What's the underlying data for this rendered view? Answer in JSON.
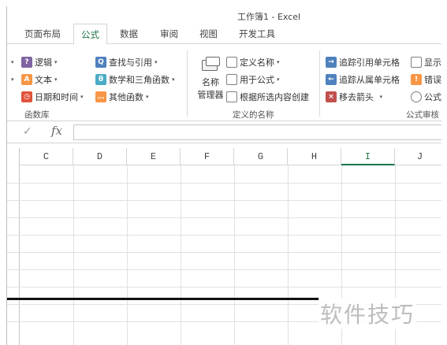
{
  "window": {
    "title": "工作簿1 - Excel"
  },
  "tabs": [
    {
      "label": "页面布局"
    },
    {
      "label": "公式",
      "active": true
    },
    {
      "label": "数据"
    },
    {
      "label": "审阅"
    },
    {
      "label": "视图"
    },
    {
      "label": "开发工具"
    }
  ],
  "ribbon": {
    "function_library": {
      "label": "函数库",
      "logic": "逻辑",
      "text": "文本",
      "datetime": "日期和时间",
      "lookup": "查找与引用",
      "math": "数学和三角函数",
      "other": "其他函数"
    },
    "defined_names": {
      "label": "定义的名称",
      "name_manager_line1": "名称",
      "name_manager_line2": "管理器",
      "define_name": "定义名称",
      "use_in_formula": "用于公式",
      "create_from_selection": "根据所选内容创建"
    },
    "formula_auditing": {
      "label": "公式审核",
      "trace_precedents": "追踪引用单元格",
      "trace_dependents": "追踪从属单元格",
      "remove_arrows": "移去箭头",
      "show": "显示",
      "error": "错误",
      "evaluate": "公式"
    }
  },
  "formula_bar": {
    "fx": "fx",
    "check": "✓",
    "value": ""
  },
  "grid": {
    "columns": [
      "C",
      "D",
      "E",
      "F",
      "G",
      "H",
      "I",
      "J"
    ],
    "selected_column": "I"
  },
  "watermark": "软件技巧",
  "colors": {
    "accent": "#217346"
  }
}
